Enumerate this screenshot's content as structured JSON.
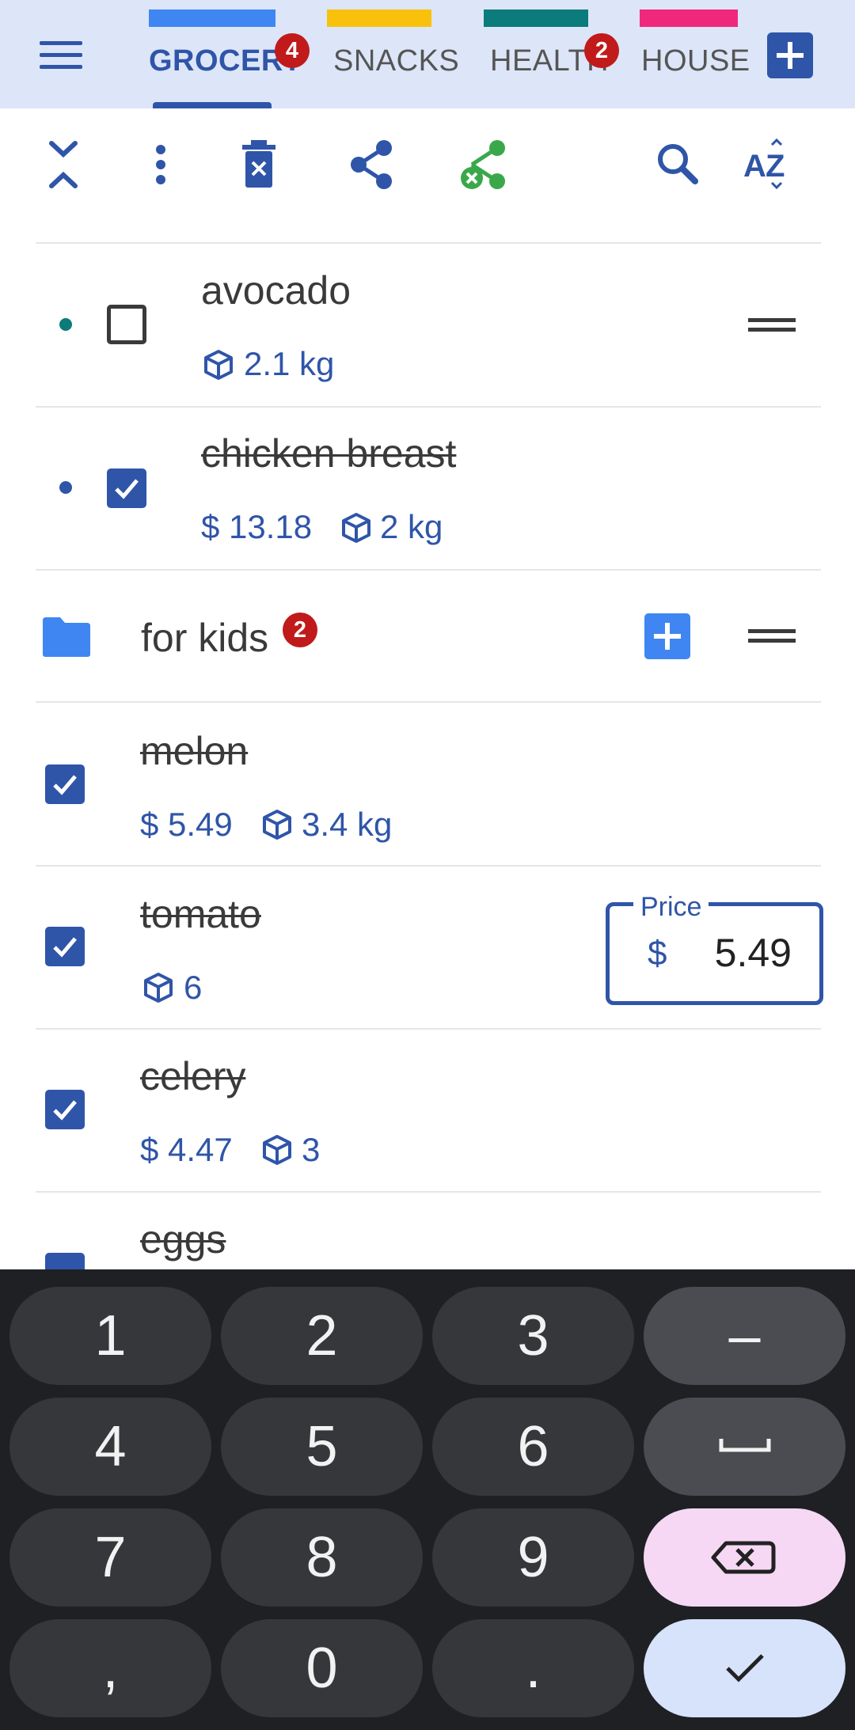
{
  "tabs": [
    {
      "label": "GROCERY",
      "color": "#3f86f2",
      "badge": "4",
      "active": true
    },
    {
      "label": "SNACKS",
      "color": "#f8c20c",
      "badge": null,
      "active": false
    },
    {
      "label": "HEALTH",
      "color": "#0b7b7b",
      "badge": "2",
      "active": false
    },
    {
      "label": "HOUSE",
      "color": "#f0287c",
      "badge": null,
      "active": false
    }
  ],
  "toolbar": {
    "icons": [
      "collapse-expand-icon",
      "more-vert-icon",
      "delete-checked-icon",
      "share-icon",
      "unshare-icon",
      "search-icon",
      "sort-az-icon"
    ]
  },
  "items": {
    "avocado": {
      "name": "avocado",
      "quantity": "2.1 kg",
      "checked": false,
      "dot_color": "#0b7b7b"
    },
    "chicken": {
      "name": "chicken breast",
      "price": "$ 13.18",
      "quantity": "2 kg",
      "checked": true,
      "dot_color": "#2f55a8"
    }
  },
  "folder": {
    "name": "for kids",
    "badge": "2"
  },
  "kids_items": {
    "melon": {
      "name": "melon",
      "price": "$ 5.49",
      "quantity": "3.4 kg",
      "checked": true
    },
    "tomato": {
      "name": "tomato",
      "quantity": "6",
      "checked": true
    },
    "celery": {
      "name": "celery",
      "price": "$ 4.47",
      "quantity": "3",
      "checked": true
    },
    "eggs": {
      "name": "eggs",
      "checked": true
    }
  },
  "price_field": {
    "label": "Price",
    "currency": "$",
    "value": "5.49"
  },
  "keyboard": {
    "keys": [
      "1",
      "2",
      "3",
      "–",
      "4",
      "5",
      "6",
      "␣",
      "7",
      "8",
      "9",
      "⌫",
      ",",
      "0",
      ".",
      "✓"
    ]
  },
  "colors": {
    "accent": "#2f55a8",
    "header_bg": "#dde5f8",
    "badge": "#c11a1a",
    "folder": "#3f86f2",
    "unshare": "#3aa84a"
  }
}
